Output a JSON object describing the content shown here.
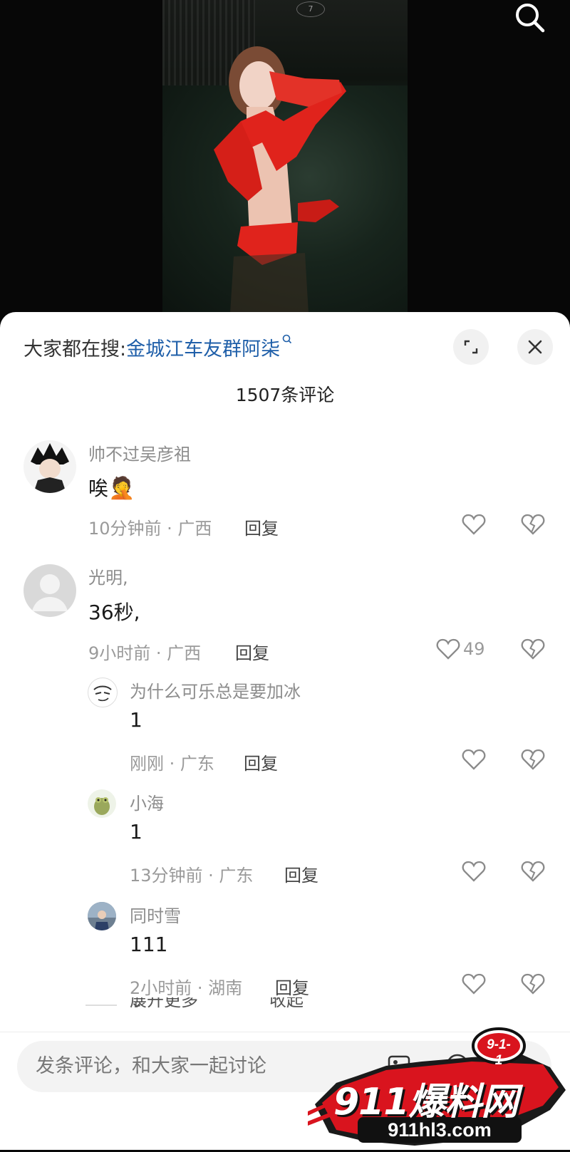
{
  "video": {
    "badge": "7"
  },
  "sheet": {
    "suggest_prefix": "大家都在搜:",
    "suggest_keyword": "金城江车友群阿柒",
    "comment_count": "1507条评论"
  },
  "comments": [
    {
      "user": "帅不过吴彦祖",
      "text": "唉",
      "emoji": "🤦",
      "time": "10分钟前 · 广西",
      "reply": "回复"
    },
    {
      "user": "光明,",
      "text": "36秒,",
      "time": "9小时前 · 广西",
      "reply": "回复",
      "likes": "49"
    }
  ],
  "replies": [
    {
      "user": "为什么可乐总是要加冰",
      "text": "1",
      "time": "刚刚 · 广东",
      "reply": "回复"
    },
    {
      "user": "小海",
      "text": "1",
      "time": "13分钟前 · 广东",
      "reply": "回复"
    },
    {
      "user": "同时雪",
      "text": "111",
      "time": "2小时前 · 湖南",
      "reply": "回复"
    }
  ],
  "thread_controls": {
    "expand_more": "展开更多",
    "collapse": "收起"
  },
  "composer": {
    "placeholder": "发条评论，和大家一起讨论"
  },
  "watermark": {
    "brand": "911爆料网",
    "url": "911hl3.com",
    "badge": "9-1-1"
  },
  "colors": {
    "keyword": "#1f5fa9",
    "watermark_red": "#d9141e",
    "swimsuit_red": "#e0231c"
  },
  "icons": [
    "search-icon",
    "expand-icon",
    "close-icon",
    "heart-icon",
    "broken-heart-icon",
    "image-icon",
    "at-icon",
    "emoji-icon"
  ]
}
